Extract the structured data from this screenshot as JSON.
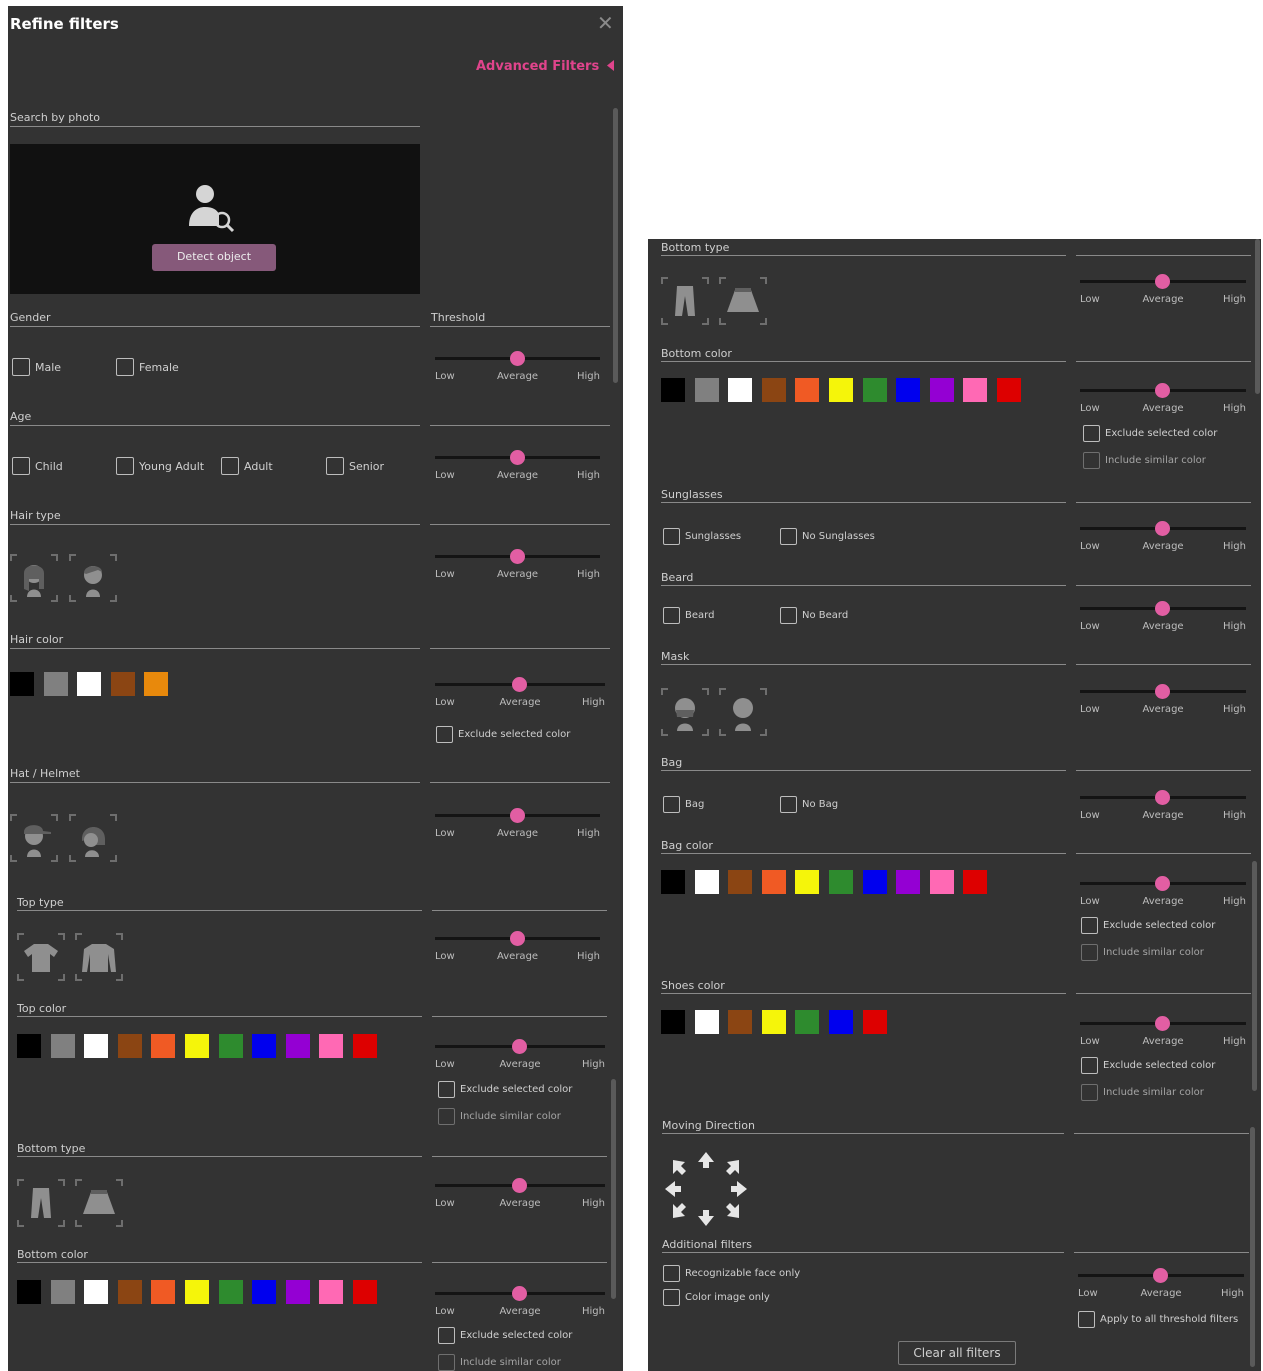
{
  "dialog": {
    "title": "Refine filters",
    "close_glyph": "✕",
    "advanced_filters": "Advanced Filters"
  },
  "slider_labels": {
    "low": "Low",
    "average": "Average",
    "high": "High"
  },
  "left": {
    "search_by_photo": "Search by photo",
    "detect_object": "Detect object",
    "gender": {
      "label": "Gender",
      "options": [
        "Male",
        "Female"
      ]
    },
    "threshold": "Threshold",
    "age": {
      "label": "Age",
      "options": [
        "Child",
        "Young Adult",
        "Adult",
        "Senior"
      ]
    },
    "hair_type": "Hair type",
    "hair_color": "Hair color",
    "hat_helmet": "Hat / Helmet",
    "top_type": "Top type",
    "top_color": "Top color",
    "bottom_type": "Bottom type",
    "bottom_color": "Bottom color"
  },
  "right": {
    "bottom_type": "Bottom type",
    "bottom_color": "Bottom color",
    "sunglasses": {
      "label": "Sunglasses",
      "options": [
        "Sunglasses",
        "No Sunglasses"
      ]
    },
    "beard": {
      "label": "Beard",
      "options": [
        "Beard",
        "No Beard"
      ]
    },
    "mask": "Mask",
    "bag": {
      "label": "Bag",
      "options": [
        "Bag",
        "No Bag"
      ]
    },
    "bag_color": "Bag color",
    "shoes_color": "Shoes color",
    "moving_direction": "Moving Direction",
    "additional_filters": {
      "label": "Additional filters",
      "options": [
        "Recognizable face only",
        "Color image only"
      ]
    },
    "apply_all": "Apply to all threshold filters",
    "clear_all": "Clear all filters"
  },
  "color_options": {
    "exclude_selected": "Exclude selected color",
    "include_similar": "Include similar color"
  },
  "colors": {
    "accent": "#e0448c",
    "slider_knob": "#e25ea3",
    "panel_bg": "#333333",
    "hair": [
      "#000000",
      "#808080",
      "#ffffff",
      "#8b4513",
      "#e8890c"
    ],
    "full_palette": [
      "#000000",
      "#808080",
      "#ffffff",
      "#8b4513",
      "#f05a24",
      "#f5f50a",
      "#2e8b2e",
      "#0000ee",
      "#9400d3",
      "#ff69b4",
      "#dd0000"
    ],
    "bag": [
      "#000000",
      "#ffffff",
      "#8b4513",
      "#f05a24",
      "#f5f50a",
      "#2e8b2e",
      "#0000ee",
      "#9400d3",
      "#ff69b4",
      "#dd0000"
    ],
    "shoes": [
      "#000000",
      "#ffffff",
      "#8b4513",
      "#f5f50a",
      "#2e8b2e",
      "#0000ee",
      "#dd0000"
    ]
  },
  "icons": {
    "close": "close-icon",
    "advanced": "chevron-left-icon",
    "photo": "person-search-icon",
    "hair_types": [
      "long-hair-icon",
      "short-hair-icon"
    ],
    "hats": [
      "cap-icon",
      "helmet-icon"
    ],
    "tops": [
      "short-sleeve-top-icon",
      "long-sleeve-top-icon"
    ],
    "bottoms": [
      "trousers-icon",
      "skirt-icon"
    ],
    "masks": [
      "mask-icon",
      "no-mask-icon"
    ],
    "direction": "moving-direction-arrows-icon"
  },
  "sliders": {
    "level": "average"
  }
}
